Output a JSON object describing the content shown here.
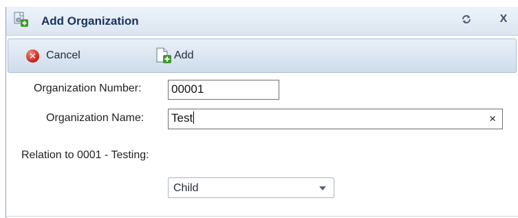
{
  "window": {
    "title": "Add Organization",
    "title_icon": "add-organization-icon",
    "refresh_icon": "refresh-icon",
    "close_label": "X"
  },
  "toolbar": {
    "cancel_label": "Cancel",
    "cancel_icon": "cancel-icon",
    "add_label": "Add",
    "add_icon": "add-document-icon"
  },
  "form": {
    "number_label": "Organization Number:",
    "number_value": "00001",
    "name_label": "Organization Name:",
    "name_value": "Test",
    "clear_label": "×",
    "relation_label": "Relation to 0001 - Testing:",
    "relation_value": "Child"
  },
  "colors": {
    "title_text": "#15325f",
    "toolbar_bg": "#dbe5f1",
    "cancel_icon": "#c81e12"
  }
}
